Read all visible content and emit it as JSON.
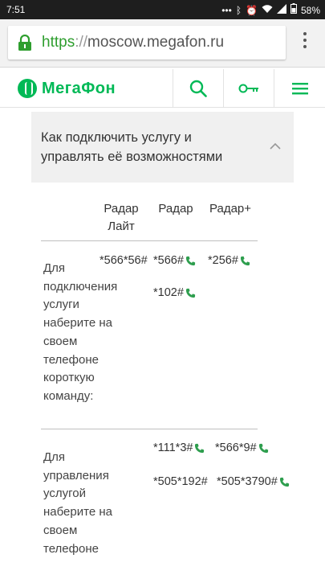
{
  "status_bar": {
    "time": "7:51",
    "icons": [
      "dots-icon",
      "bluetooth-icon",
      "alarm-icon",
      "wifi-icon",
      "signal-icon",
      "battery-icon"
    ],
    "battery": "58%"
  },
  "browser": {
    "url_scheme": "https",
    "url_separator": "://",
    "url_host": "moscow.megafon.ru"
  },
  "header": {
    "logo_text": "МегаФон",
    "brand_color": "#00b956"
  },
  "accordion": {
    "title": "Как подключить услугу и управлять её возможностями"
  },
  "table": {
    "columns": [
      "Радар Лайт",
      "Радар",
      "Радар+"
    ],
    "rows": [
      {
        "label": "Для подключения услуги наберите на своем телефоне короткую команду:",
        "codes": [
          [
            "*566*56#"
          ],
          [
            "*566#",
            "*102#"
          ],
          [
            "*256#"
          ]
        ]
      },
      {
        "label": "Для управления услугой наберите на своем телефоне",
        "codes": [
          [],
          [
            "*111*3#",
            "*505*192#"
          ],
          [
            "*566*9#",
            "*505*3790#"
          ]
        ]
      }
    ]
  }
}
